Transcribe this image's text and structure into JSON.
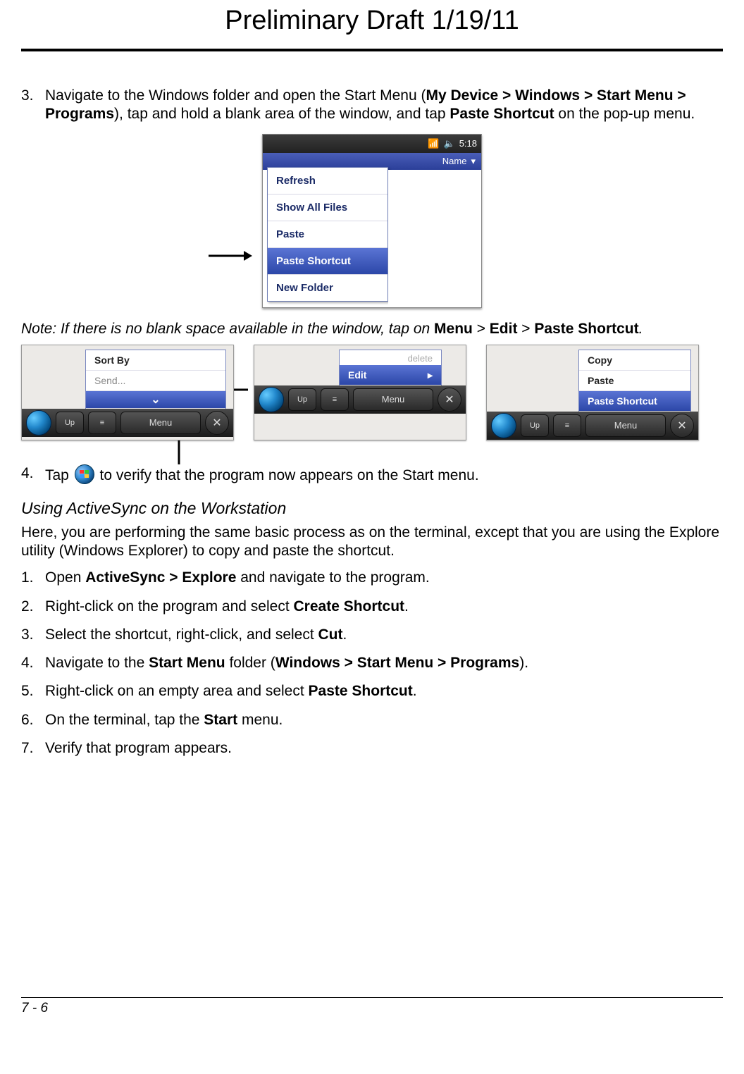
{
  "header": {
    "draft_title": "Preliminary Draft 1/19/11"
  },
  "step3": {
    "num": "3.",
    "pre": "Navigate to the Windows folder and open the Start Menu (",
    "path": "My Device > Windows > Start Menu > Programs",
    "mid": "), tap and hold a blank area of the window, and tap ",
    "action": "Paste Shortcut",
    "post": " on the pop-up menu."
  },
  "shot1": {
    "titlebar_left": "",
    "time": "5:18",
    "col": "Name",
    "menu": {
      "i0": "Refresh",
      "i1": "Show All Files",
      "i2": "Paste",
      "i3": "Paste Shortcut",
      "i4": "New Folder"
    }
  },
  "note": {
    "pre": "Note: If there is no blank space available in the window, tap on ",
    "m": "Menu",
    "gt1": " > ",
    "e": "Edit",
    "gt2": " > ",
    "ps": "Paste Shortcut",
    "post": "."
  },
  "row3": {
    "a": {
      "i0": "Sort By",
      "i1": "Send...",
      "chev": "⌄"
    },
    "b": {
      "head": "delete",
      "i0": "Edit"
    },
    "c": {
      "i0": "Copy",
      "i1": "Paste",
      "i2": "Paste Shortcut"
    },
    "tb": {
      "up": "Up",
      "menu": "Menu",
      "close": "✕",
      "mid": "≡"
    }
  },
  "step4": {
    "num": "4.",
    "pre": "Tap ",
    "post": " to verify that the program now appears on the Start menu."
  },
  "section2": {
    "title": "Using ActiveSync on the Workstation",
    "intro": "Here, you are performing the same basic process as on the terminal, except that you are using the Explore utility (Windows Explorer) to copy and paste the shortcut."
  },
  "s1": {
    "num": "1.",
    "a": "Open ",
    "b": "ActiveSync > Explore",
    "c": " and navigate to the program."
  },
  "s2": {
    "num": "2.",
    "a": "Right-click on the program and select ",
    "b": "Create Shortcut",
    "c": "."
  },
  "s3": {
    "num": "3.",
    "a": "Select the shortcut, right-click, and select ",
    "b": "Cut",
    "c": "."
  },
  "s4": {
    "num": "4.",
    "a": "Navigate to the ",
    "b": "Start Menu",
    "c": " folder (",
    "d": "Windows > Start Menu > Programs",
    "e": ")."
  },
  "s5": {
    "num": "5.",
    "a": "Right-click on an empty area and select ",
    "b": "Paste Shortcut",
    "c": "."
  },
  "s6": {
    "num": "6.",
    "a": "On the terminal, tap the ",
    "b": "Start",
    "c": " menu."
  },
  "s7": {
    "num": "7.",
    "a": "Verify that program appears."
  },
  "footer": {
    "page": "7 - 6"
  }
}
